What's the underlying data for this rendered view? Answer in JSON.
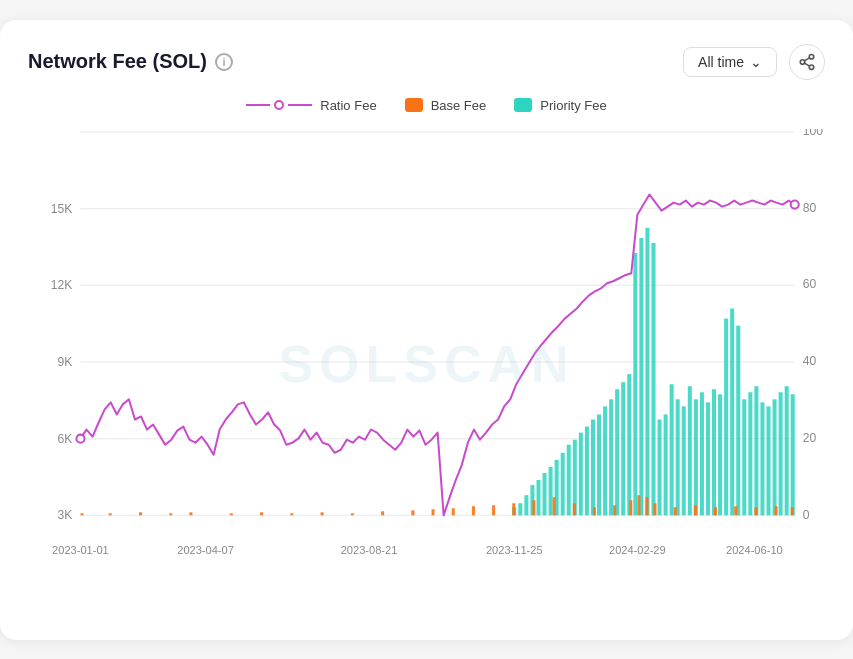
{
  "header": {
    "title": "Network Fee (SOL)",
    "info_icon": "i",
    "time_selector_label": "All time",
    "share_icon": "share"
  },
  "legend": {
    "items": [
      {
        "id": "ratio-fee",
        "label": "Ratio Fee",
        "type": "line-dot",
        "color": "#c84bcc"
      },
      {
        "id": "base-fee",
        "label": "Base Fee",
        "type": "box",
        "color": "#f97316"
      },
      {
        "id": "priority-fee",
        "label": "Priority Fee",
        "type": "box",
        "color": "#2dd4bf"
      }
    ]
  },
  "chart": {
    "x_labels": [
      "2023-01-01",
      "2023-04-07",
      "2023-08-21",
      "2023-11-25",
      "2024-02-29",
      "2024-06-10"
    ],
    "y_left_labels": [
      "3K",
      "6K",
      "9K",
      "12K",
      "15K"
    ],
    "y_right_labels": [
      "0",
      "20",
      "40",
      "60",
      "80",
      "100"
    ],
    "watermark": "SOLSCAN"
  },
  "colors": {
    "ratio_fee": "#c84bcc",
    "base_fee": "#f97316",
    "priority_fee": "#2dd4bf",
    "grid": "#e8e8e8",
    "text": "#888"
  }
}
